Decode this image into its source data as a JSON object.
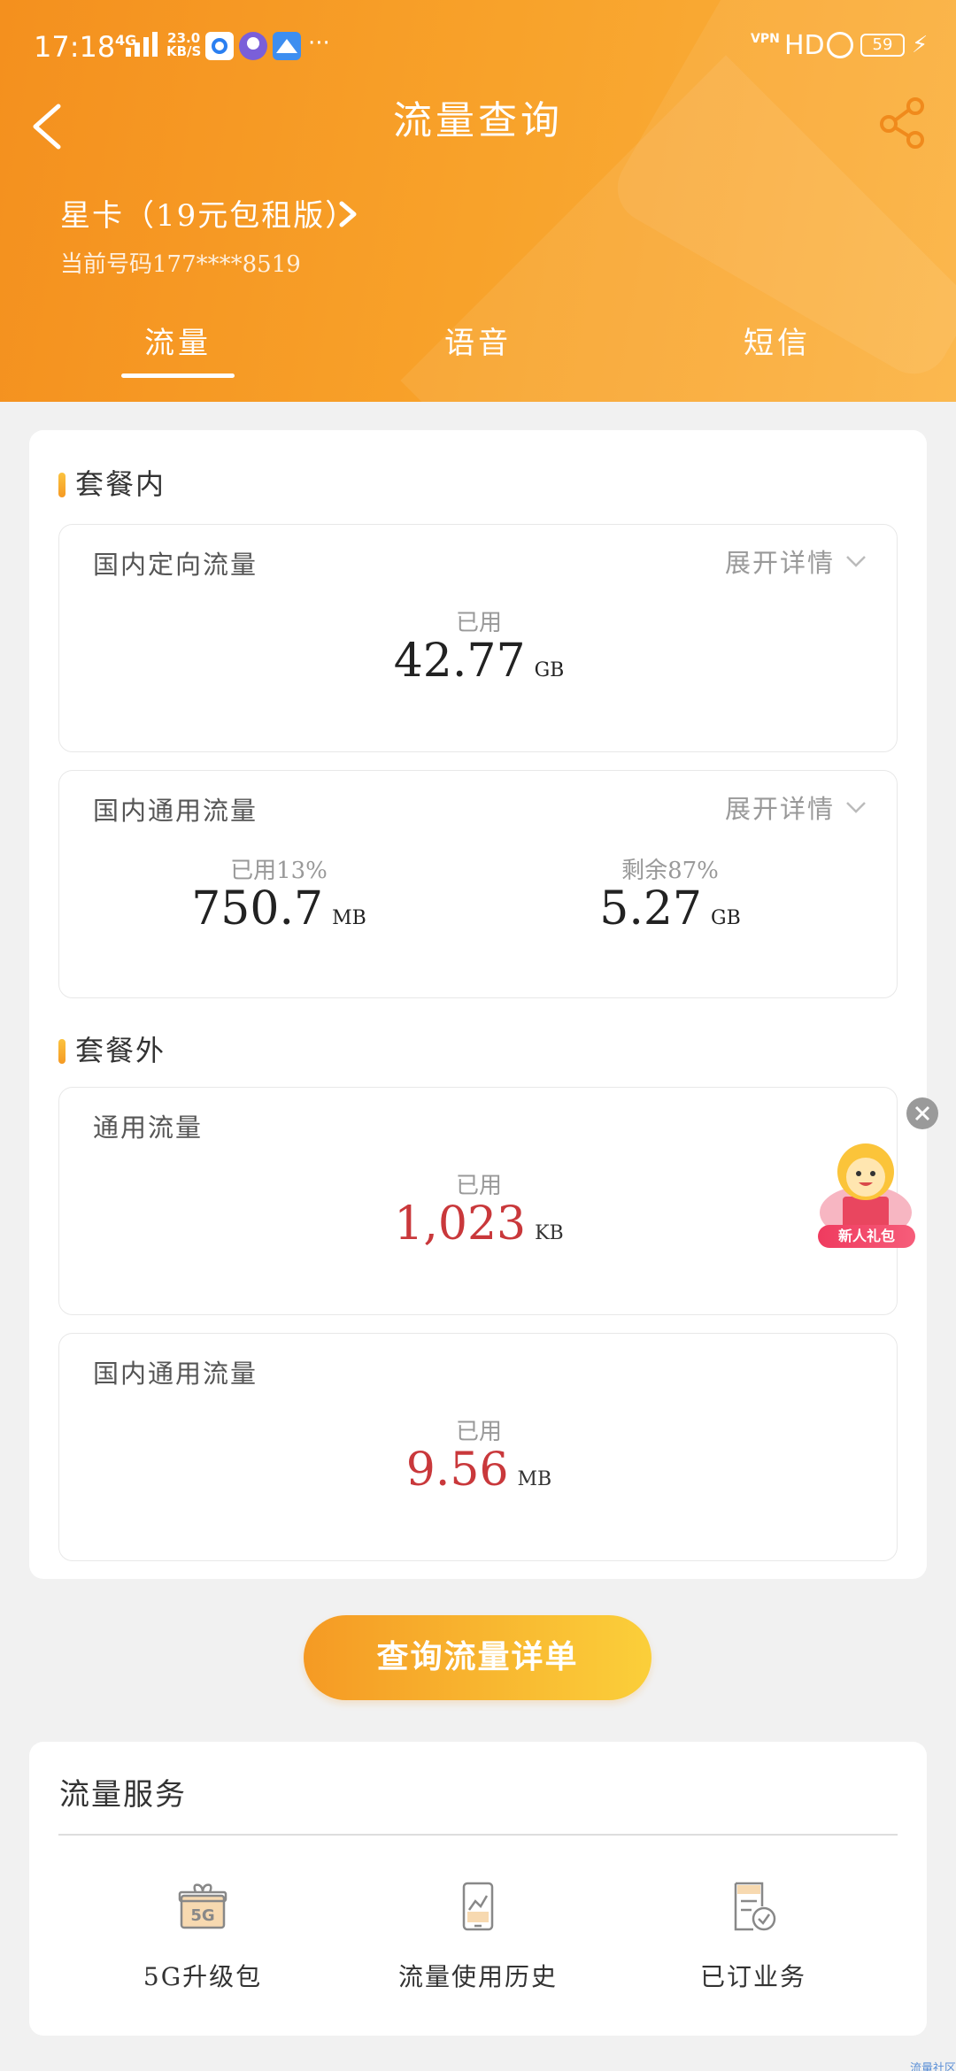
{
  "status_bar": {
    "time": "17:18",
    "network": "4G",
    "speed_value": "23.0",
    "speed_unit": "KB/S",
    "more": "···",
    "vpn": "VPN",
    "hd": "HD",
    "battery": "59",
    "app_icons": [
      "browser-app-icon",
      "avatar-app-icon",
      "mountain-app-icon"
    ]
  },
  "header": {
    "title": "流量查询",
    "plan_name": "星卡（19元包租版）",
    "phone_number": "当前号码177****8519"
  },
  "tabs": [
    {
      "label": "流量",
      "active": true
    },
    {
      "label": "语音",
      "active": false
    },
    {
      "label": "短信",
      "active": false
    }
  ],
  "in_plan": {
    "section_title": "套餐内",
    "directional": {
      "title": "国内定向流量",
      "expand_label": "展开详情",
      "used_label": "已用",
      "used_value": "42.77",
      "used_unit": "GB"
    },
    "general": {
      "title": "国内通用流量",
      "expand_label": "展开详情",
      "used_label": "已用13%",
      "used_value": "750.7",
      "used_unit": "MB",
      "remain_label": "剩余87%",
      "remain_value": "5.27",
      "remain_unit": "GB"
    }
  },
  "out_plan": {
    "section_title": "套餐外",
    "general": {
      "title": "通用流量",
      "used_label": "已用",
      "used_value": "1,023",
      "used_unit": "KB"
    },
    "domestic": {
      "title": "国内通用流量",
      "used_label": "已用",
      "used_value": "9.56",
      "used_unit": "MB"
    }
  },
  "query_button": "查询流量详单",
  "services": {
    "title": "流量服务",
    "items": [
      {
        "label": "5G升级包",
        "icon": "5g-gift-icon",
        "icon_text": "5G"
      },
      {
        "label": "流量使用历史",
        "icon": "usage-history-icon"
      },
      {
        "label": "已订业务",
        "icon": "subscribed-services-icon"
      }
    ]
  },
  "float_gift": {
    "label": "新人礼包"
  },
  "corner_text": "流量社区",
  "colors": {
    "header_start": "#f4901e",
    "header_end": "#fbb240",
    "accent_red": "#c9383b",
    "button_start": "#f59a24",
    "button_end": "#fbcf3a"
  }
}
